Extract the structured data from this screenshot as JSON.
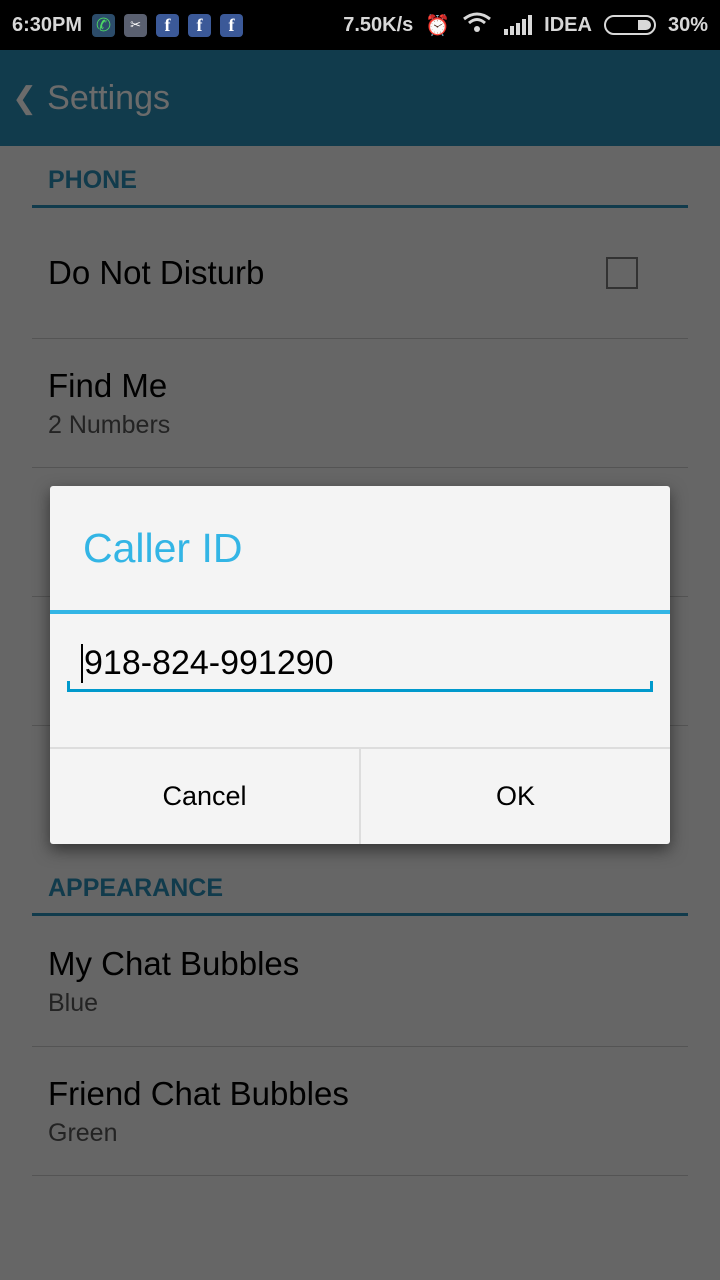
{
  "status_bar": {
    "time": "6:30PM",
    "notifications": [
      "whatsapp-icon",
      "scissors-app-icon",
      "facebook-icon",
      "facebook-icon",
      "facebook-icon"
    ],
    "net_speed": "7.50K/s",
    "carrier": "IDEA",
    "battery_percent": "30%",
    "battery_level": 0.3
  },
  "app_bar": {
    "back_glyph": "❮",
    "title": "Settings"
  },
  "sections": [
    {
      "header": "PHONE",
      "items": [
        {
          "label": "Do Not Disturb",
          "checked": false
        },
        {
          "label": "Find Me",
          "sub": "2 Numbers"
        },
        {
          "label": "",
          "sub": ""
        },
        {
          "label": "",
          "sub": ""
        }
      ]
    },
    {
      "header": "APPEARANCE",
      "items": [
        {
          "label": "My Chat Bubbles",
          "sub": "Blue"
        },
        {
          "label": "Friend Chat Bubbles",
          "sub": "Green"
        }
      ]
    }
  ],
  "dialog": {
    "title": "Caller ID",
    "input_value": "918-824-991290",
    "cancel_label": "Cancel",
    "ok_label": "OK"
  },
  "colors": {
    "accent": "#33b5e5",
    "app_bar": "#2a8eb5",
    "field_underline": "#0099cc"
  }
}
